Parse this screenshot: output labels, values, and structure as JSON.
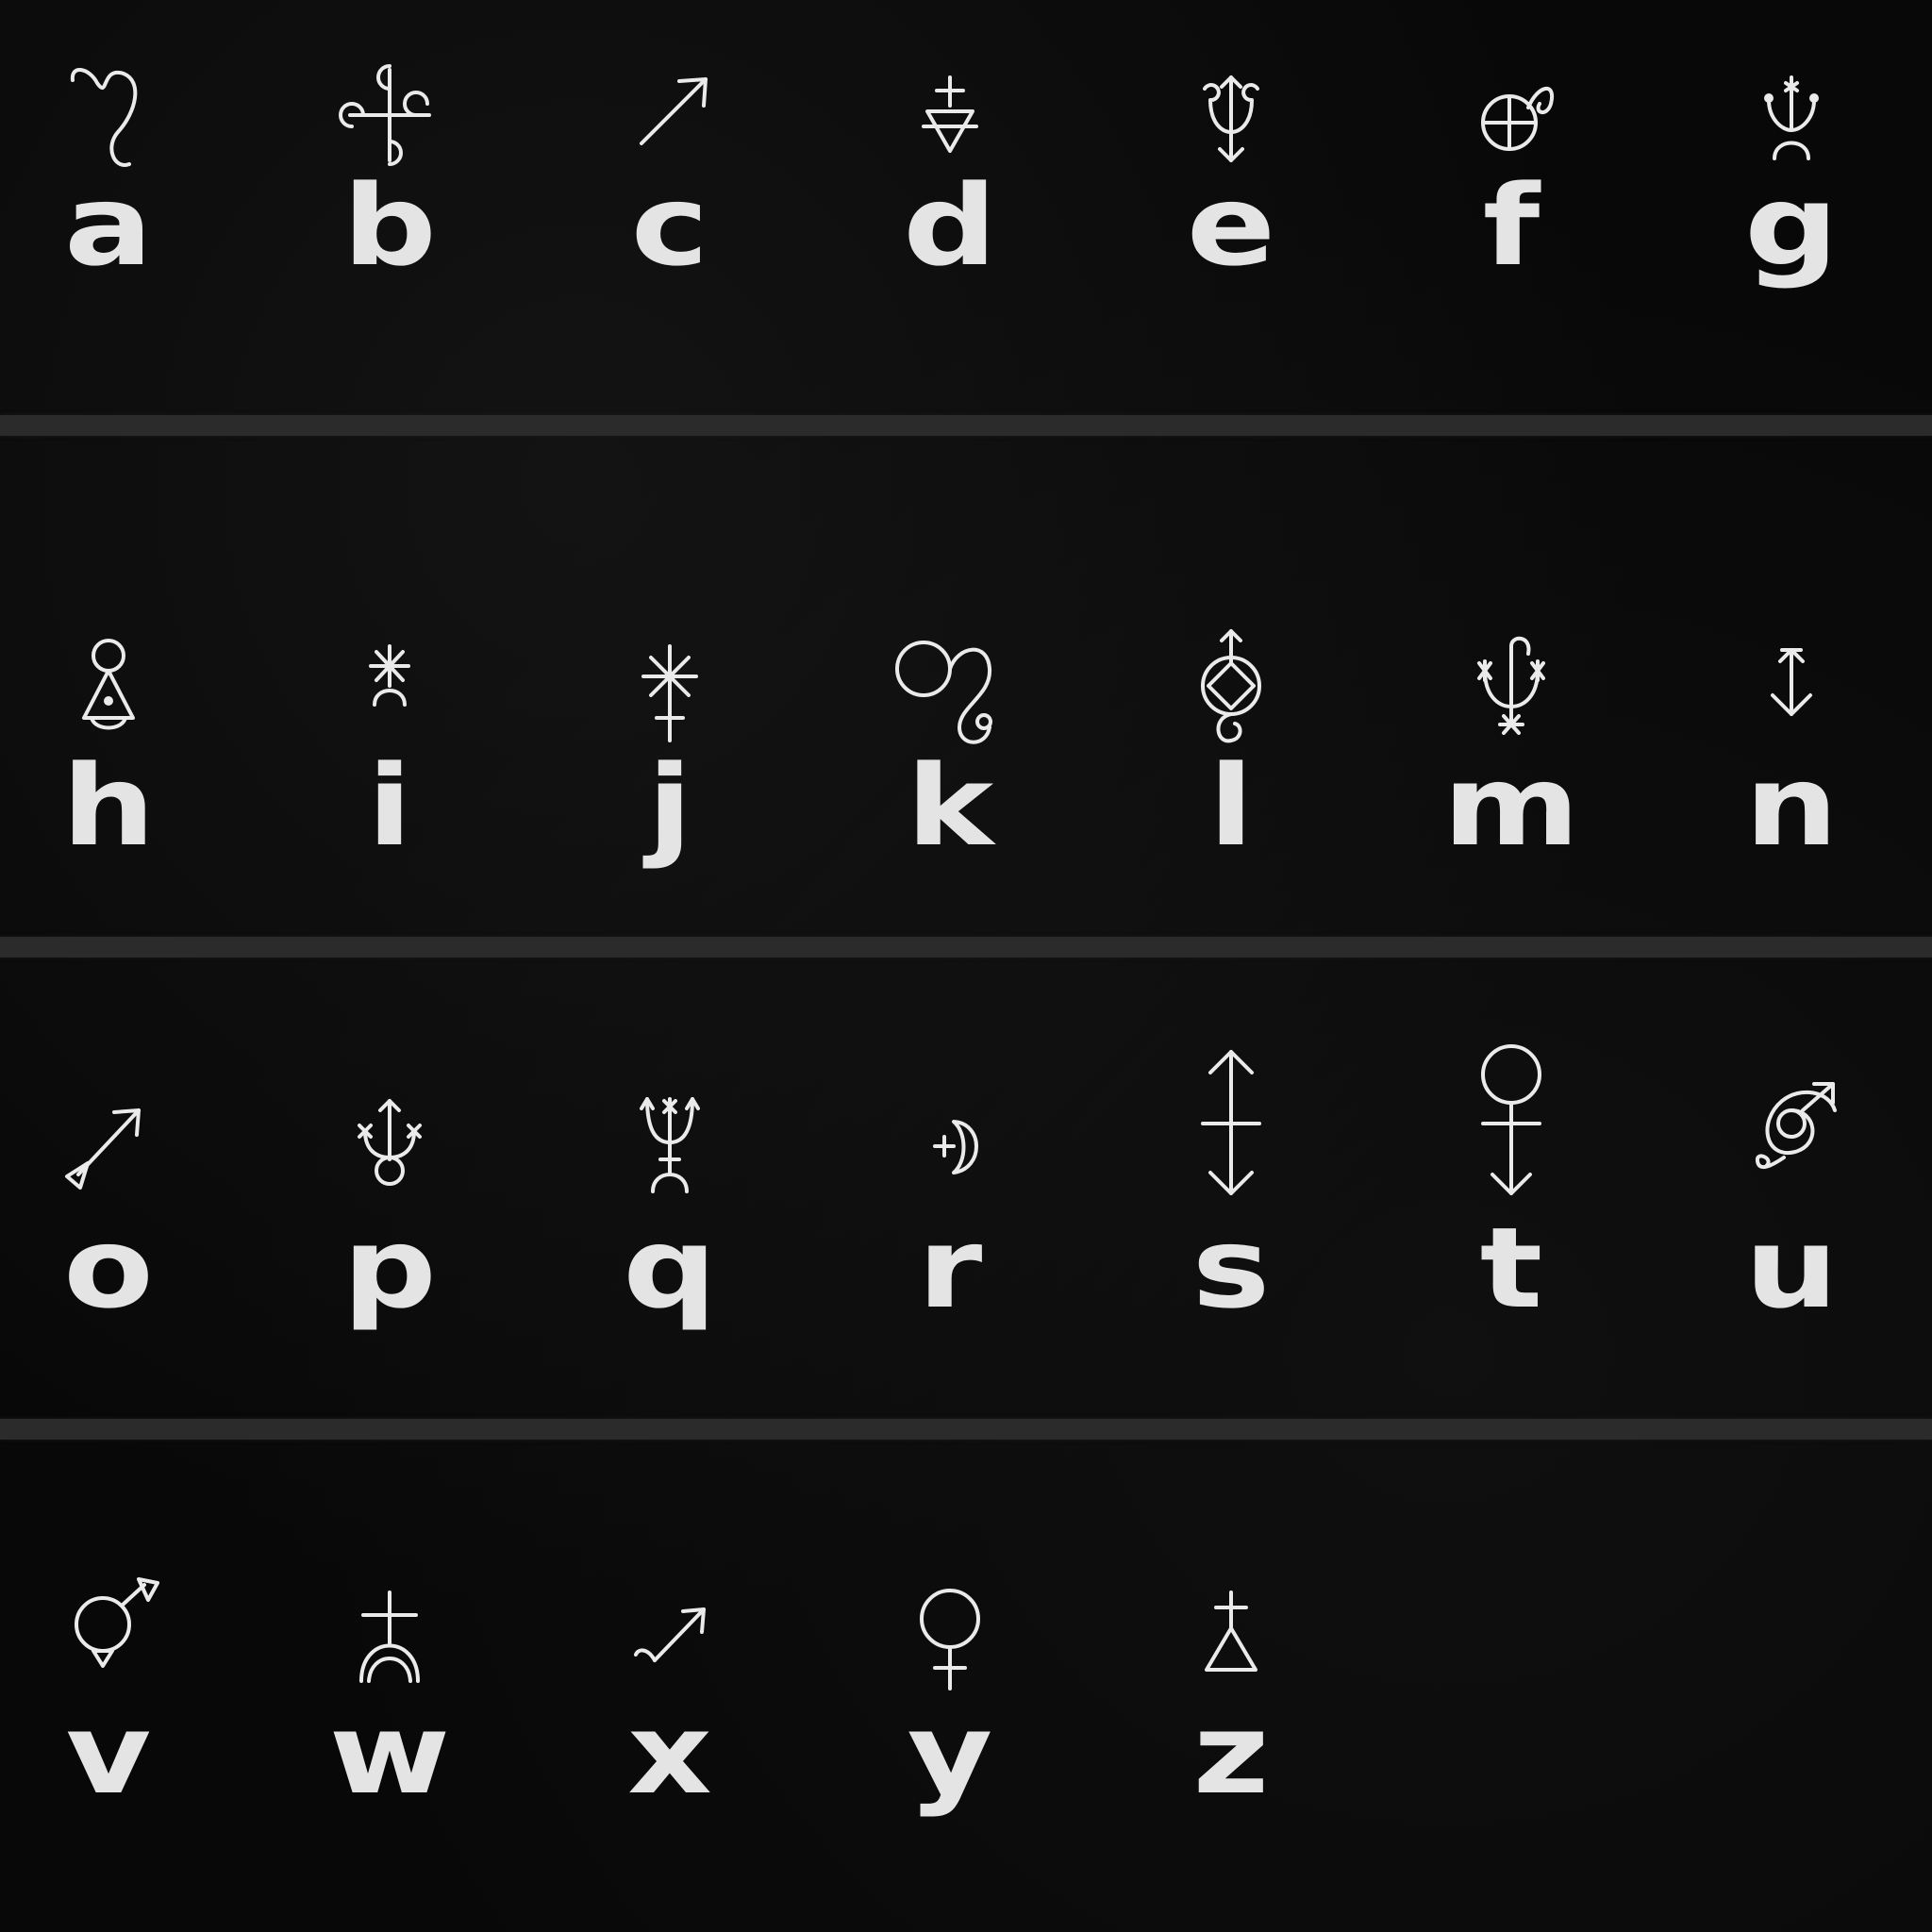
{
  "palette": {
    "background": "#080808",
    "divider": "#2b2b2b",
    "ink": "#eaeaea"
  },
  "rows": [
    {
      "cells": [
        {
          "letter": "a",
          "icon": "leo-curl-icon"
        },
        {
          "letter": "b",
          "icon": "quatrefoil-cross-icon"
        },
        {
          "letter": "c",
          "icon": "diagonal-arrow-icon"
        },
        {
          "letter": "d",
          "icon": "triangle-cross-icon"
        },
        {
          "letter": "e",
          "icon": "trident-arrow-icon"
        },
        {
          "letter": "f",
          "icon": "circled-cross-hook-icon"
        },
        {
          "letter": "g",
          "icon": "star-trident-crescent-icon"
        }
      ]
    },
    {
      "cells": [
        {
          "letter": "h",
          "icon": "circle-triangle-dot-icon"
        },
        {
          "letter": "i",
          "icon": "asterisk-crescent-icon"
        },
        {
          "letter": "j",
          "icon": "asterisk-cross-icon"
        },
        {
          "letter": "k",
          "icon": "loop-spiral-icon"
        },
        {
          "letter": "l",
          "icon": "diamond-circle-arrow-icon"
        },
        {
          "letter": "m",
          "icon": "stars-trident-icon"
        },
        {
          "letter": "n",
          "icon": "double-arrow-icon"
        }
      ]
    },
    {
      "cells": [
        {
          "letter": "o",
          "icon": "arrow-triangle-icon"
        },
        {
          "letter": "p",
          "icon": "arrow-circle-crosses-icon"
        },
        {
          "letter": "q",
          "icon": "trident-crescent-icon"
        },
        {
          "letter": "r",
          "icon": "crescent-cross-icon"
        },
        {
          "letter": "s",
          "icon": "long-double-arrow-cross-icon"
        },
        {
          "letter": "t",
          "icon": "circle-cross-arrow-icon"
        },
        {
          "letter": "u",
          "icon": "spiral-arrow-icon"
        }
      ]
    },
    {
      "cells": [
        {
          "letter": "v",
          "icon": "circle-arrow-triangle-icon"
        },
        {
          "letter": "w",
          "icon": "cross-crescent-icon"
        },
        {
          "letter": "x",
          "icon": "hooked-arrow-icon"
        },
        {
          "letter": "y",
          "icon": "venus-icon"
        },
        {
          "letter": "z",
          "icon": "cross-triangle-icon"
        }
      ]
    }
  ]
}
